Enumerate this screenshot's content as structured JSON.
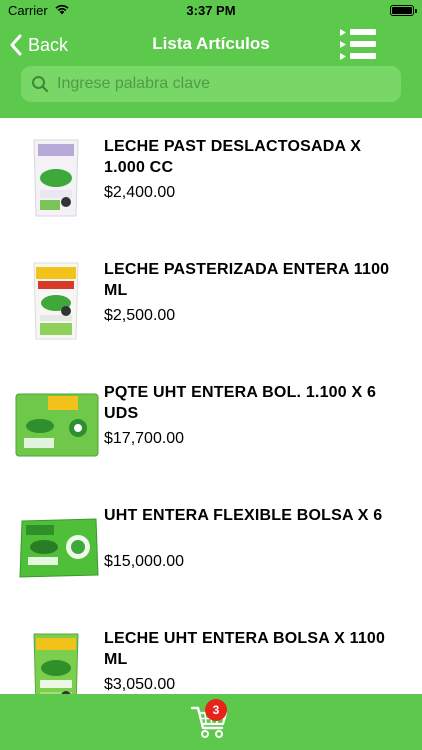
{
  "status_bar": {
    "carrier": "Carrier",
    "time": "3:37 PM"
  },
  "nav": {
    "back_label": "Back",
    "title": "Lista Artículos"
  },
  "search": {
    "placeholder": "Ingrese palabra clave"
  },
  "items": [
    {
      "name": "LECHE PAST DESLACTOSADA X 1.000 CC",
      "price": "$2,400.00"
    },
    {
      "name": "LECHE PASTERIZADA ENTERA 1100 ML",
      "price": "$2,500.00"
    },
    {
      "name": "PQTE UHT ENTERA BOL. 1.100 X 6 UDS",
      "price": "$17,700.00"
    },
    {
      "name": "UHT ENTERA FLEXIBLE BOLSA X 6",
      "price": "$15,000.00"
    },
    {
      "name": "LECHE UHT ENTERA BOLSA X 1100 ML",
      "price": "$3,050.00"
    }
  ],
  "cart": {
    "count": "3"
  },
  "icons": {
    "wifi": "wifi-icon",
    "battery": "battery-icon",
    "back": "chevron-left-icon",
    "menu": "list-menu-icon",
    "search": "search-icon",
    "cart": "shopping-cart-icon"
  },
  "colors": {
    "brand_green": "#5cc94d",
    "search_bg": "#79d768",
    "badge_red": "#e8231a"
  }
}
